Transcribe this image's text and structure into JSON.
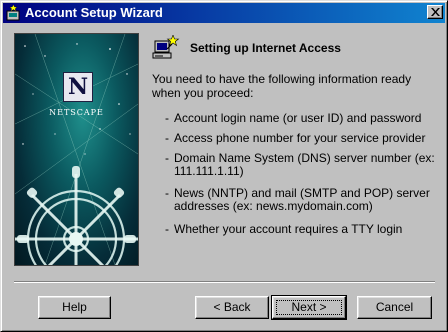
{
  "window": {
    "title": "Account Setup Wizard"
  },
  "banner": {
    "logo_letter": "N",
    "logo_word": "NETSCAPE"
  },
  "content": {
    "heading": "Setting up Internet Access",
    "intro": "You need to have the following information ready when you proceed:",
    "items": [
      "Account login name (or user ID) and password",
      "Access phone number for your service provider",
      "Domain Name System (DNS) server number (ex: 111.111.1.11)",
      "News (NNTP) and mail (SMTP and POP) server addresses (ex: news.mydomain.com)",
      "Whether your account requires a TTY login"
    ],
    "bullet": "-"
  },
  "buttons": {
    "help": "Help",
    "back": "< Back",
    "next": "Next >",
    "cancel": "Cancel"
  },
  "colors": {
    "titlebar_start": "#000080",
    "titlebar_end": "#1084d0",
    "face": "#c0c0c0"
  },
  "icons": {
    "title": "netscape-wizard-icon",
    "close": "close-icon",
    "heading": "computer-wizard-icon"
  }
}
